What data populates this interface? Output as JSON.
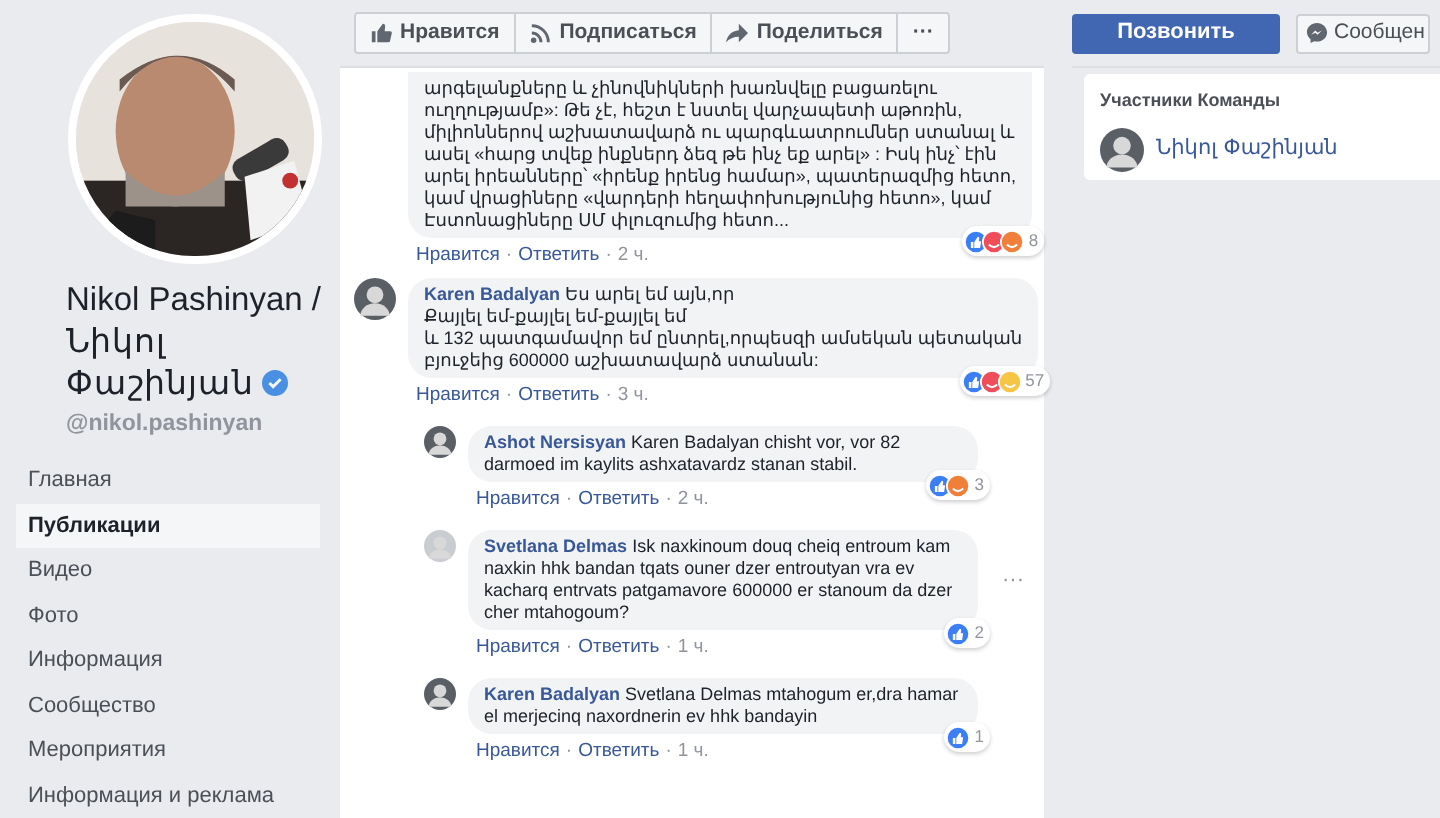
{
  "profile": {
    "name": "Nikol Pashinyan / Նիկոլ Փաշինյան",
    "handle": "@nikol.pashinyan",
    "verified": true
  },
  "nav": [
    {
      "label": "Главная",
      "selected": false
    },
    {
      "label": "Публикации",
      "selected": true
    },
    {
      "label": "Видео",
      "selected": false
    },
    {
      "label": "Фото",
      "selected": false
    },
    {
      "label": "Информация",
      "selected": false
    },
    {
      "label": "Сообщество",
      "selected": false
    },
    {
      "label": "Мероприятия",
      "selected": false
    },
    {
      "label": "Информация и реклама",
      "selected": false
    }
  ],
  "actions": [
    {
      "kind": "like",
      "label": "Нравится"
    },
    {
      "kind": "follow",
      "label": "Подписаться"
    },
    {
      "kind": "share",
      "label": "Поделиться"
    },
    {
      "kind": "more",
      "label": "···"
    }
  ],
  "call_button": "Позвонить",
  "message_button": "Сообщен",
  "team": {
    "title": "Участники Команды",
    "members": [
      "Նիկոլ Փաշինյան"
    ]
  },
  "comments": [
    {
      "reply": false,
      "text": "արգելանքները և չինովնիկների խառնվելը բացառելու\nուղղությամբ»: Թե չէ, հեշտ է նստել վարչապետի աթոռին,\nմիլիոններով աշխատավարձ ու պարգևատրումներ ստանալ և\nասել «հարց տվեք ինքներդ ձեզ թե ինչ եք արել» : Իսկ ինչ՝ էին\nարել իրեանները՝ «իրենք իրենց համար», պատերազմից հետո,\nկամ վրացիները «վարդերի հեղափոխությունից հետո», կամ\nԷստոնացիները ՍՄ փլուզումից հետո...",
      "reactions": [
        {
          "kind": "like"
        },
        {
          "kind": "haha"
        },
        {
          "kind": "angry"
        }
      ],
      "count": "8",
      "like": "Нравится",
      "sep1": "·",
      "answer": "Ответить",
      "sep2": "·",
      "time": "2 ч."
    },
    {
      "reply": false,
      "author": "Karen Badalyan",
      "text": "Ես արել եմ այն,որ\nՔայլել եմ-քայլել եմ-քայլել եմ\nև 132 պատգամավոր եմ ընտրել,որպեսզի ամսեկան պետական\nբյուջեից 600000 աշխատավարձ ստանան:",
      "reactions": [
        {
          "kind": "like"
        },
        {
          "kind": "haha"
        },
        {
          "kind": "laugh"
        }
      ],
      "count": "57",
      "like": "Нравится",
      "sep1": "·",
      "answer": "Ответить",
      "sep2": "·",
      "time": "3 ч."
    },
    {
      "reply": true,
      "author": "Ashot Nersisyan",
      "text": "Karen Badalyan chisht vor, vor 82\ndarmoed im kaylits ashxatavardz stanan stabil.",
      "reactions": [
        {
          "kind": "like"
        },
        {
          "kind": "angry"
        }
      ],
      "count": "3",
      "like": "Нравится",
      "sep1": "·",
      "answer": "Ответить",
      "sep2": "·",
      "time": "2 ч."
    },
    {
      "reply": true,
      "author": "Svetlana Delmas",
      "text": "Isk naxkinoum douq cheiq entroum kam\nnaxkin hhk bandan tqats ouner dzer entroutyan vra ev\nkacharq entrvats patgamavore 600000 er stanoum da dzer\ncher mtahogoum?",
      "reactions": [
        {
          "kind": "like"
        }
      ],
      "count": "2",
      "like": "Нравится",
      "sep1": "·",
      "answer": "Ответить",
      "sep2": "·",
      "time": "1 ч.",
      "more": "···"
    },
    {
      "reply": true,
      "author": "Karen Badalyan",
      "text": "Svetlana Delmas mtahogum er,dra hamar\nel merjecinq naxordnerin ev hhk bandayin",
      "reactions": [
        {
          "kind": "like"
        }
      ],
      "count": "1",
      "like": "Нравится",
      "sep1": "·",
      "answer": "Ответить",
      "sep2": "·",
      "time": "1 ч."
    }
  ]
}
